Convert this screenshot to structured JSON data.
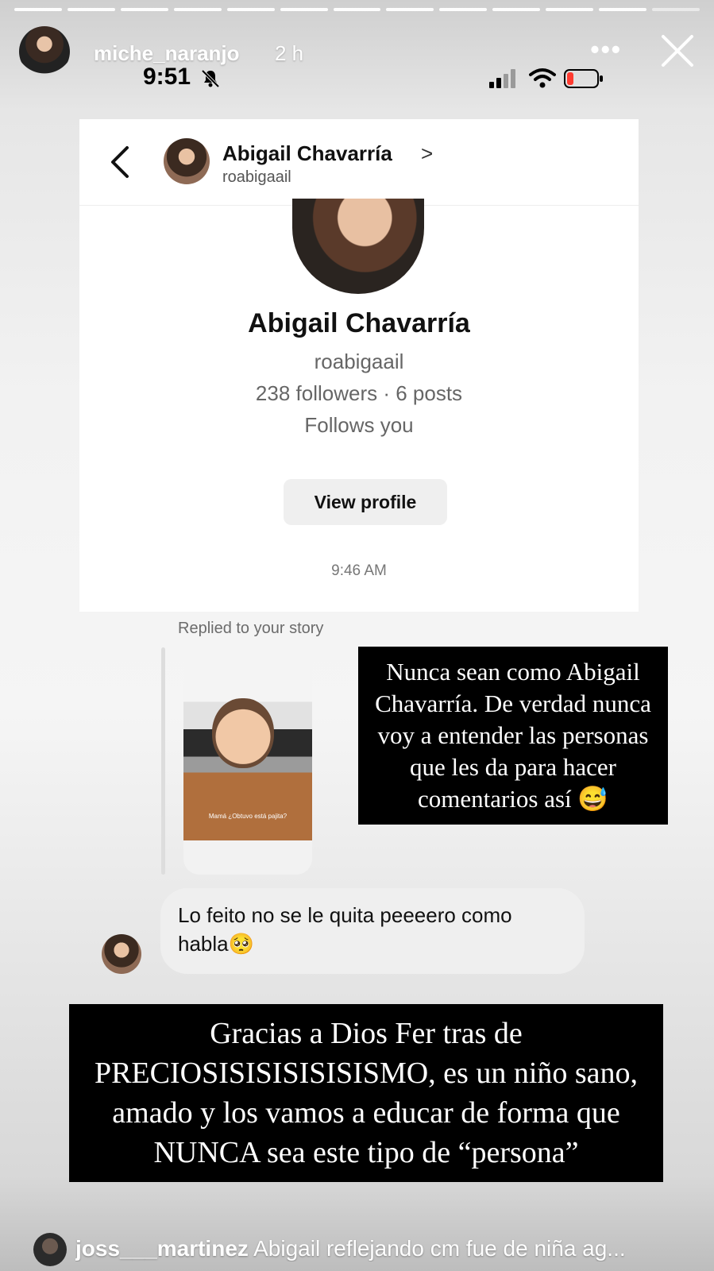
{
  "story": {
    "username": "miche_naranjo",
    "time": "2 h",
    "more_icon": "more-horizontal-icon",
    "close_icon": "close-icon",
    "progress_segments": 13,
    "active_segment": 12
  },
  "status_bar": {
    "time": "9:51",
    "icons": [
      "bell-slash-icon",
      "signal-icon",
      "wifi-icon",
      "battery-icon"
    ],
    "battery_color": "#ff3b30"
  },
  "dm": {
    "back_icon": "back-chevron-icon",
    "name": "Abigail Chavarría",
    "chevron": ">",
    "username": "roabigaail",
    "profile": {
      "name": "Abigail Chavarría",
      "username": "roabigaail",
      "stats": "238 followers · 6 posts",
      "follows": "Follows you",
      "view_profile_label": "View profile"
    },
    "message_time": "9:46 AM",
    "replied_label": "Replied to your story",
    "story_thumb_caption": "Mamá ¿Obtuvo está pajita?",
    "reply_message": "Lo feito no se le quita peeeero como habla🥺"
  },
  "overlays": {
    "top": "Nunca sean como Abigail Chavarría. De verdad nunca voy a entender las personas que les da para hacer comentarios así 😅",
    "bottom": "Gracias a Dios Fer tras de PRECIOSISISISISISISMO, es un niño sano, amado y los vamos a educar de forma que NUNCA sea este tipo de “persona”"
  },
  "bottom_comment": {
    "username": "joss___martinez",
    "text": "Abigail reflejando cm fue de niña ag..."
  }
}
